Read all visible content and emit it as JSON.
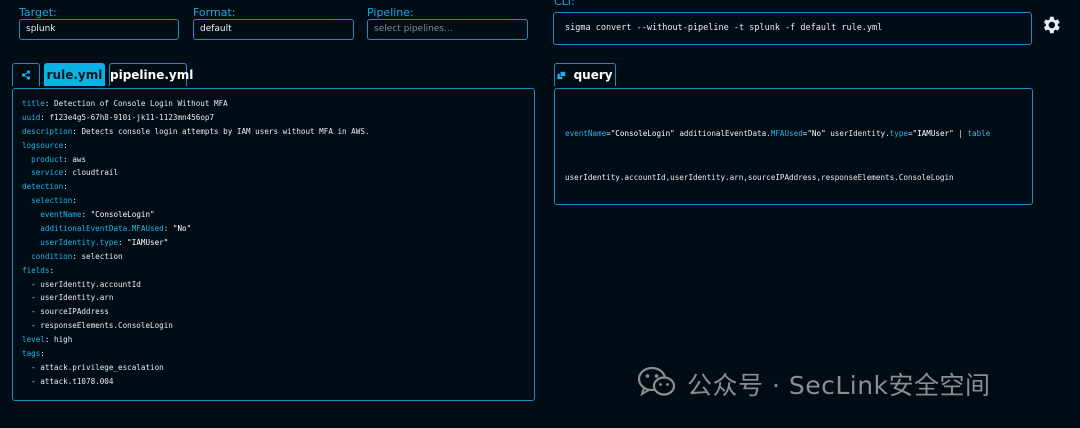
{
  "form": {
    "target": {
      "label": "Target:",
      "value": "splunk"
    },
    "format": {
      "label": "Format:",
      "value": "default"
    },
    "pipeline": {
      "label": "Pipeline:",
      "placeholder": "select pipelines..."
    }
  },
  "cli": {
    "label": "CLI:",
    "command": "sigma convert --without-pipeline -t splunk -f default rule.yml"
  },
  "tabs": [
    {
      "label": "rule.yml",
      "active": true
    },
    {
      "label": "pipeline.yml",
      "active": false
    }
  ],
  "query_tab": {
    "label": "query"
  },
  "rule_lines": [
    {
      "key": "title",
      "value": " Detection of Console Login Without MFA"
    },
    {
      "key": "uuid",
      "value": " f123e4g5-67h8-910i-jk11-1123mn456op7"
    },
    {
      "key": "description",
      "value": " Detects console login attempts by IAM users without MFA in AWS."
    },
    {
      "key": "logsource",
      "value": ""
    },
    {
      "indent": "  ",
      "key": "product",
      "value": " aws"
    },
    {
      "indent": "  ",
      "key": "service",
      "value": " cloudtrail"
    },
    {
      "key": "detection",
      "value": ""
    },
    {
      "indent": "  ",
      "key": "selection",
      "value": ""
    },
    {
      "indent": "    ",
      "key": "eventName",
      "value": " \"ConsoleLogin\""
    },
    {
      "indent": "    ",
      "key": "additionalEventData.MFAUsed",
      "value": " \"No\""
    },
    {
      "indent": "    ",
      "key": "userIdentity.type",
      "value": " \"IAMUser\""
    },
    {
      "indent": "  ",
      "key": "condition",
      "value": " selection"
    },
    {
      "key": "fields",
      "value": ""
    },
    {
      "text": "  - userIdentity.accountId"
    },
    {
      "text": "  - userIdentity.arn"
    },
    {
      "text": "  - sourceIPAddress"
    },
    {
      "text": "  - responseElements.ConsoleLogin"
    },
    {
      "key": "level",
      "value": " high"
    },
    {
      "key": "tags",
      "value": ""
    },
    {
      "text": "  - attack.privilege_escalation"
    },
    {
      "text": "  - attack.t1078.004"
    }
  ],
  "query": {
    "line1": [
      {
        "t": "eventName",
        "c": "k"
      },
      {
        "t": "=",
        "c": "p"
      },
      {
        "t": "\"ConsoleLogin\"",
        "c": "s"
      },
      {
        "t": " additionalEventData.",
        "c": "p"
      },
      {
        "t": "MFAUsed",
        "c": "k"
      },
      {
        "t": "=",
        "c": "p"
      },
      {
        "t": "\"No\"",
        "c": "s"
      },
      {
        "t": " userIdentity.",
        "c": "p"
      },
      {
        "t": "type",
        "c": "k"
      },
      {
        "t": "=",
        "c": "p"
      },
      {
        "t": "\"IAMUser\"",
        "c": "s"
      },
      {
        "t": " | ",
        "c": "p"
      },
      {
        "t": "table",
        "c": "op"
      }
    ],
    "line2": "userIdentity.accountId,userIdentity.arn,sourceIPAddress,responseElements.ConsoleLogin"
  },
  "watermark": {
    "text": "公众号 · SecLink安全空间",
    "icon": "wechat-icon"
  },
  "icons": {
    "share": "share-icon",
    "settings": "gear-icon",
    "query": "cube-icon"
  }
}
